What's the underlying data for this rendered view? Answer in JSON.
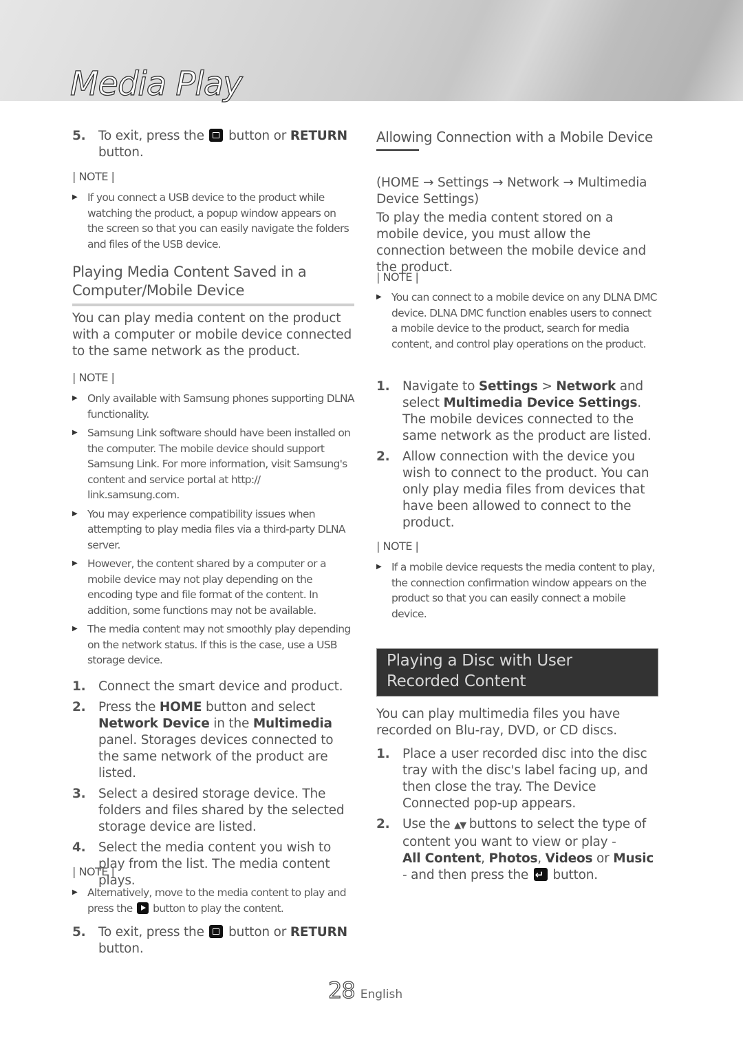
{
  "header": {
    "chapter_title": "Media Play"
  },
  "left_column": {
    "step5_top": {
      "num": "5.",
      "pre": "To exit, press the",
      "icon": "stop-button-icon",
      "mid": "button or",
      "bold": "RETURN",
      "post": "button."
    },
    "note1": {
      "label": "| NOTE |",
      "bullets": [
        "If you connect a USB device to the product while watching the product, a popup window appears on the screen so that you can easily navigate the folders and files of the USB device."
      ]
    },
    "section_heading": "Playing Media Content Saved in a Computer/Mobile Device",
    "intro": "You can play media content on the product with a computer or mobile device connected to the same network as the product.",
    "note2": {
      "label": "| NOTE |",
      "bullets": [
        "Only available with Samsung phones supporting DLNA functionality.",
        "Samsung Link software should have been installed on the computer. The mobile device should support Samsung Link. For more information, visit Samsung's content and service portal at http:// link.samsung.com.",
        "You may experience compatibility issues when attempting to play media files via a third-party DLNA server.",
        "However, the content shared by a computer or a mobile device may not play depending on the encoding type and file format of the content. In addition, some functions may not be available.",
        "The media content may not smoothly play depending on the network status. If this is the case, use a USB storage device."
      ]
    },
    "steps": [
      {
        "num": "1.",
        "text": "Connect the smart device and product."
      },
      {
        "num": "2.",
        "pre": "Press the",
        "b1": "HOME",
        "mid1": "button and select",
        "b2": "Network Device",
        "mid2": "in the",
        "b3": "Multimedia",
        "post": "panel. Storages devices connected to the same network of the product are listed."
      },
      {
        "num": "3.",
        "text": "Select a desired storage device. The folders and files shared by the selected storage device are listed."
      },
      {
        "num": "4.",
        "text": "Select the media content you wish to play from the list. The media content plays."
      }
    ],
    "note3": {
      "label": "| NOTE |",
      "pre": "Alternatively, move to the media content to play and press the",
      "icon": "play-button-icon",
      "post": "button to play the content."
    },
    "step5_bottom": {
      "num": "5.",
      "pre": "To exit, press the",
      "icon": "stop-button-icon",
      "mid": "button or",
      "bold": "RETURN",
      "post": "button."
    }
  },
  "right_column": {
    "section_heading": "Allowing Connection with a Mobile Device",
    "path": "(HOME → Settings → Network → Multimedia Device Settings)",
    "intro": "To play the media content stored on a mobile device, you must allow the connection between the mobile device and the product.",
    "note1": {
      "label": "| NOTE |",
      "bullets": [
        "You can connect to a mobile device on any DLNA DMC device. DLNA DMC function enables users to connect a mobile device to the product, search for media content, and control play operations on the product."
      ]
    },
    "steps": [
      {
        "num": "1.",
        "pre": "Navigate to",
        "b1": "Settings",
        "sep": ">",
        "b2": "Network",
        "mid": "and select",
        "b3": "Multimedia Device Settings",
        "post": ". The mobile devices connected to the same network as the product are listed."
      },
      {
        "num": "2.",
        "text": "Allow connection with the device you wish to connect to the product. You can only play media files from devices that have been allowed to connect to the product."
      }
    ],
    "note2": {
      "label": "| NOTE |",
      "bullets": [
        "If a mobile device requests the media content to play, the connection confirmation window appears on the product so that you can easily connect a mobile device."
      ]
    },
    "disc_section": {
      "heading": "Playing a Disc with User Recorded Content",
      "intro": "You can play multimedia files you have recorded on Blu-ray, DVD, or CD discs.",
      "step1": {
        "num": "1.",
        "text": "Place a user recorded disc into the disc tray with the disc's label facing up, and then close the tray. The Device Connected pop-up appears."
      },
      "step2": {
        "num": "2.",
        "pre": "Use the",
        "arrows": "▲▼",
        "mid": "buttons to select the type of content you want to view or play -",
        "opt1": "All Content",
        "comma1": ",",
        "opt2": "Photos",
        "comma2": ",",
        "opt3": "Videos",
        "or": "or",
        "opt4": "Music",
        "post": "- and then press the",
        "icon": "enter-button-icon",
        "end": "button."
      }
    }
  },
  "footer": {
    "page_number": "28",
    "language": "English"
  }
}
